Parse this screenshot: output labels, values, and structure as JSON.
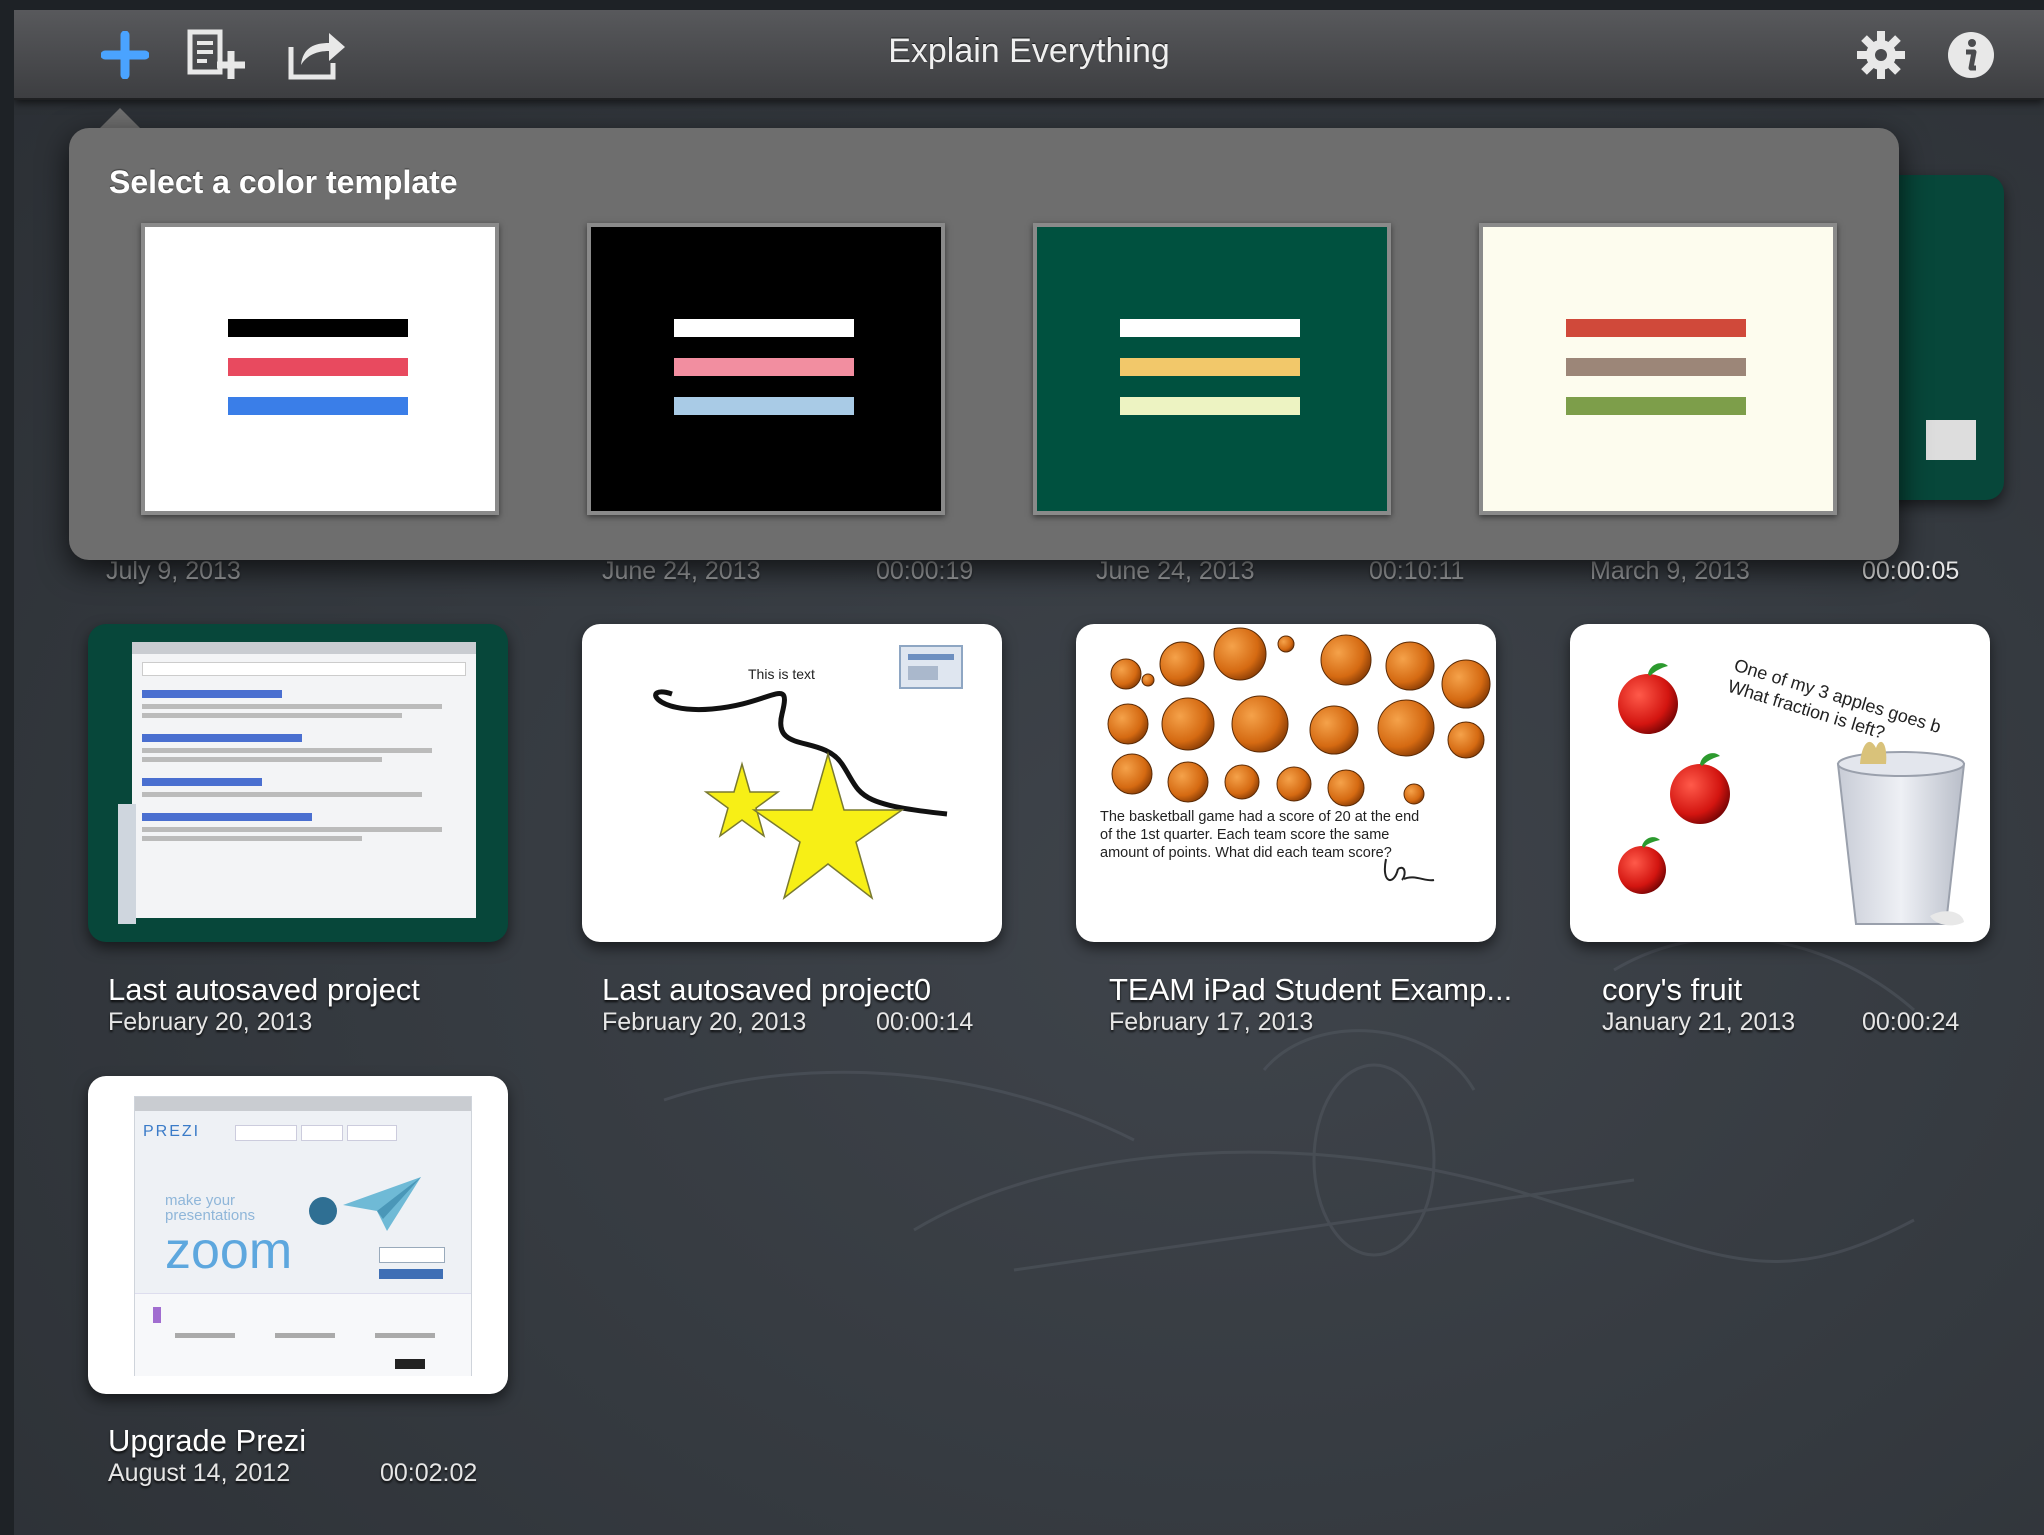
{
  "app": {
    "title": "Explain Everything"
  },
  "toolbar": {
    "icons": [
      "add-icon",
      "import-icon",
      "export-icon",
      "gear-icon",
      "info-icon"
    ]
  },
  "popover": {
    "title": "Select a color template",
    "templates": [
      {
        "name": "white",
        "bg": "#ffffff",
        "bars": [
          "#000000",
          "#e84a5f",
          "#3a7ee8"
        ]
      },
      {
        "name": "black",
        "bg": "#000000",
        "bars": [
          "#ffffff",
          "#f28ea0",
          "#a9cbe6"
        ]
      },
      {
        "name": "green",
        "bg": "#00513f",
        "bars": [
          "#ffffff",
          "#f2c86a",
          "#edf3c2"
        ]
      },
      {
        "name": "cream",
        "bg": "#fdfcee",
        "bars": [
          "#d0493a",
          "#9c8678",
          "#7d9e4a"
        ]
      }
    ]
  },
  "projects_row1": [
    {
      "date": "July 9, 2013",
      "duration": ""
    },
    {
      "date": "June 24, 2013",
      "duration": "00:00:19"
    },
    {
      "date": "June 24, 2013",
      "duration": "00:10:11"
    },
    {
      "date": "March 9, 2013",
      "duration": "00:00:05"
    }
  ],
  "projects_row2": [
    {
      "title": "Last autosaved project",
      "date": "February 20, 2013",
      "duration": ""
    },
    {
      "title": "Last autosaved project0",
      "date": "February 20, 2013",
      "duration": "00:00:14",
      "thumb_text": "This is text"
    },
    {
      "title": "TEAM iPad Student Examp...",
      "date": "February 17, 2013",
      "duration": "",
      "thumb_text": "The basketball game had a score of 20 at the end of the 1st quarter. Each team score the same amount of points.  What did each team score?"
    },
    {
      "title": "cory's fruit",
      "date": "January 21, 2013",
      "duration": "00:00:24",
      "thumb_text": "One of my 3 apples goes b What fraction is left?"
    }
  ],
  "projects_row3": [
    {
      "title": "Upgrade Prezi",
      "date": "August 14, 2012",
      "duration": "00:02:02",
      "thumb_text": "zoom",
      "thumb_logo": "PREZI",
      "thumb_sub": "make your presentations"
    }
  ],
  "colors": {
    "toolbar_accent": "#4aa3ff",
    "green_card": "#07473a"
  }
}
